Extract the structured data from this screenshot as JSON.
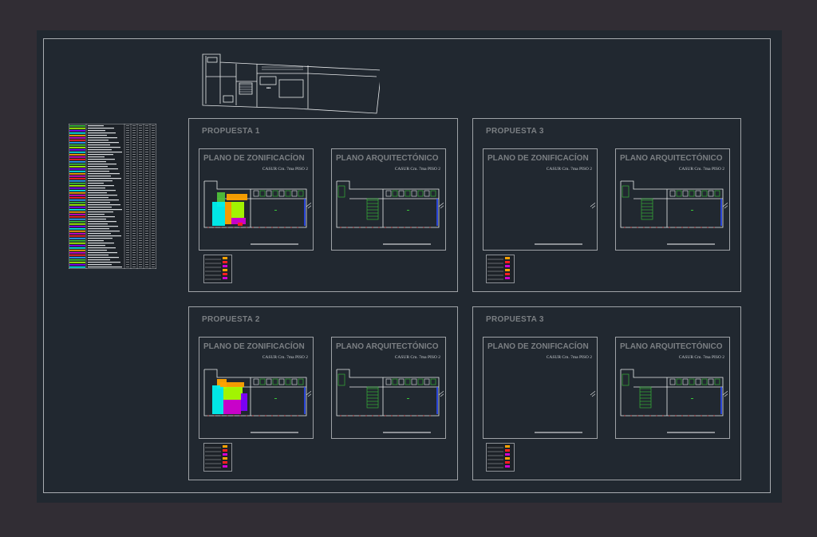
{
  "proposals": [
    {
      "title": "PROPUESTA 1",
      "frames": [
        {
          "title": "PLANO DE ZONIFICACÍON",
          "sub": "CASUR Cm. 7ma    PISO 2"
        },
        {
          "title": "PLANO ARQUITECTÓNICO",
          "sub": "CASUR Cm. 7ma    PISO 2"
        }
      ]
    },
    {
      "title": "PROPUESTA 3",
      "frames": [
        {
          "title": "PLANO DE ZONIFICACÍON",
          "sub": "CASUR Cm. 7ma    PISO 2"
        },
        {
          "title": "PLANO ARQUITECTÓNICO",
          "sub": "CASUR Cm. 7ma    PISO 2"
        }
      ]
    },
    {
      "title": "PROPUESTA 2",
      "frames": [
        {
          "title": "PLANO DE ZONIFICACÍON",
          "sub": "CASUR Cm. 7ma    PISO 2"
        },
        {
          "title": "PLANO ARQUITECTÓNICO",
          "sub": "CASUR Cm. 7ma    PISO 2"
        }
      ]
    },
    {
      "title": "PROPUESTA 3",
      "frames": [
        {
          "title": "PLANO DE ZONIFICACÍON",
          "sub": "CASUR Cm. 7ma    PISO 2"
        },
        {
          "title": "PLANO ARQUITECTÓNICO",
          "sub": "CASUR Cm. 7ma    PISO 2"
        }
      ]
    }
  ],
  "colors": {
    "background": "#312d34",
    "canvas": "#212830",
    "zone_cyan": "#00f0f0",
    "zone_green": "#4fbf3a",
    "zone_lime": "#aaff00",
    "zone_magenta": "#d200d2",
    "zone_orange": "#ffa200",
    "zone_purple": "#7f00ff",
    "room_green": "#39c639",
    "wall_red": "#ff2020",
    "wall_blue": "#2a4cff"
  }
}
